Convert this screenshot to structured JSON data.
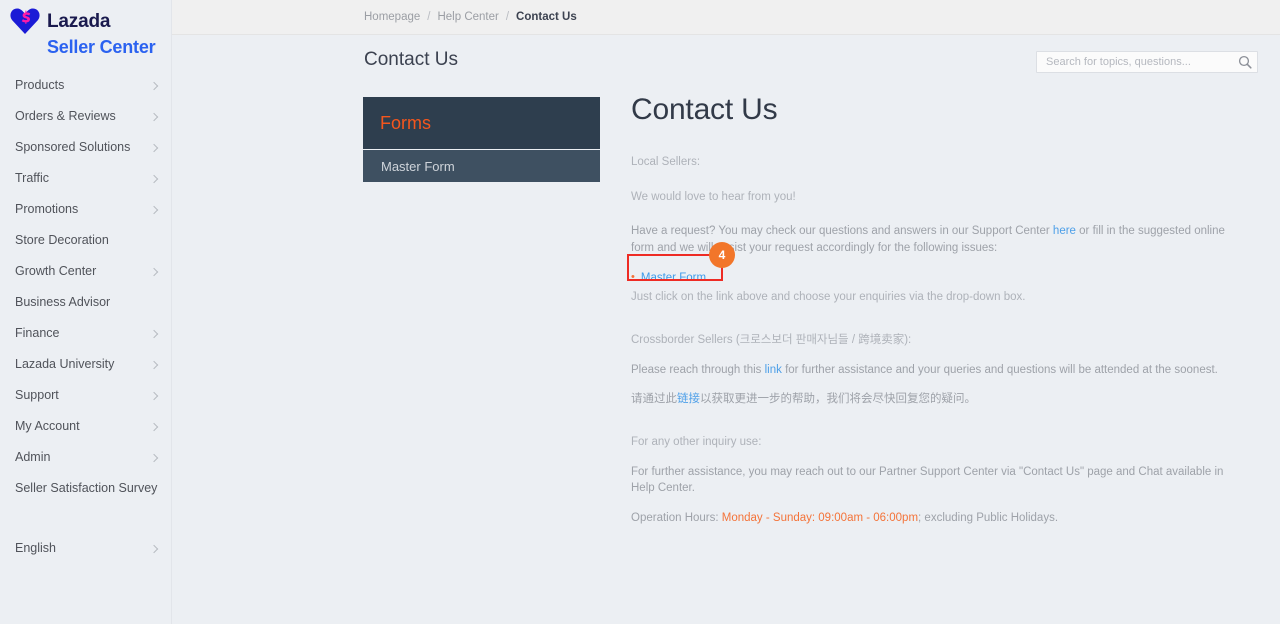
{
  "brand": {
    "name": "Lazada",
    "subtitle": "Seller Center",
    "logo_icon": "lazada-heart-logo",
    "logo_colors": {
      "heart": "#1b1bd6",
      "letter": "#ff1aa8",
      "name": "#1a1a4e",
      "sub": "#2b62f0"
    }
  },
  "sidebar": {
    "items": [
      {
        "label": "Products",
        "chevron": true
      },
      {
        "label": "Orders & Reviews",
        "chevron": true
      },
      {
        "label": "Sponsored Solutions",
        "chevron": true
      },
      {
        "label": "Traffic",
        "chevron": true
      },
      {
        "label": "Promotions",
        "chevron": true
      },
      {
        "label": "Store Decoration",
        "chevron": false
      },
      {
        "label": "Growth Center",
        "chevron": true
      },
      {
        "label": "Business Advisor",
        "chevron": false
      },
      {
        "label": "Finance",
        "chevron": true
      },
      {
        "label": "Lazada University",
        "chevron": true
      },
      {
        "label": "Support",
        "chevron": true
      },
      {
        "label": "My Account",
        "chevron": true
      },
      {
        "label": "Admin",
        "chevron": true
      },
      {
        "label": "Seller Satisfaction Survey",
        "chevron": false
      }
    ],
    "language": {
      "label": "English",
      "chevron": true
    }
  },
  "breadcrumb": {
    "items": [
      {
        "label": "Homepage"
      },
      {
        "label": "Help Center"
      },
      {
        "label": "Contact Us"
      }
    ],
    "separator": "/"
  },
  "header": {
    "page_title": "Contact Us"
  },
  "search": {
    "placeholder": "Search for topics, questions...",
    "value": "",
    "icon": "search-icon"
  },
  "forms_panel": {
    "heading": "Forms",
    "heading_color": "#f4561d",
    "items": [
      {
        "label": "Master Form"
      }
    ]
  },
  "article": {
    "title": "Contact Us",
    "local_sellers_label": "Local Sellers:",
    "intro": "We would love to hear from you!",
    "request_prefix": "Have a request? You may check our questions and answers in our Support Center ",
    "request_link": "here",
    "request_suffix": " or fill in the suggested online form and we will assist your request accordingly for the following issues:",
    "bullet_link": "Master Form",
    "bullet_note": "Just click on the link above and choose your enquiries via the drop-down box.",
    "crossborder_label": "Crossborder Sellers (크로스보더 판매자님들 / 跨境卖家):",
    "crossborder_en_prefix": "Please reach through this ",
    "crossborder_en_link": "link",
    "crossborder_en_suffix": " for further assistance and your queries and questions will be attended at the soonest.",
    "crossborder_cn_prefix": "请通过此",
    "crossborder_cn_link": "链接",
    "crossborder_cn_suffix": "以获取更进一步的帮助，我们将会尽快回复您的疑问。",
    "other_inquiry_label": "For any other inquiry use:",
    "further_assistance": "For further assistance, you may reach out to our Partner Support Center via \"Contact Us\" page and Chat available in Help Center.",
    "operation_hours_label": "Operation Hours: ",
    "operation_hours_value": "Monday - Sunday: 09:00am - 06:00pm",
    "operation_hours_suffix": "; excluding Public Holidays."
  },
  "annotation": {
    "step_number": "4",
    "badge_color": "#f2762a",
    "highlight_color": "#ee2b24",
    "target": "Master Form"
  }
}
